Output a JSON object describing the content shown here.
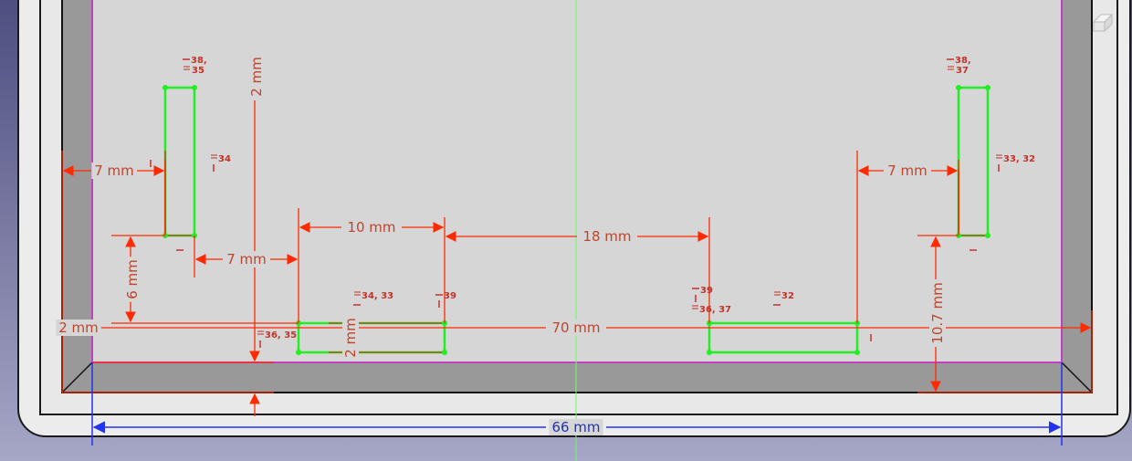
{
  "colors": {
    "background_top": "#5a5a86",
    "background_bottom": "#a2a2c4",
    "frame_outer": "#ececec",
    "frame_border": "#1a1a1a",
    "frame_wall": "#9a9a9a",
    "canvas": "#d6d6d6",
    "geometry": "#22ee22",
    "dimension": "#ff2a00",
    "dimension_text": "#c0442c",
    "reference_dimension": "#2233ee",
    "axis": "#66ff66",
    "edge_magenta": "#c040c0"
  },
  "dimensions": {
    "left_slot_offset": "7 mm",
    "right_slot_offset": "7 mm",
    "gap_to_pocket": "7 mm",
    "pocket_width": "10 mm",
    "pocket_spacing": "18 mm",
    "total_width": "70 mm",
    "inner_width": "66 mm",
    "left_height": "6 mm",
    "right_height": "10.7 mm",
    "vertical_clearance": "2 mm",
    "left_wall": "2 mm",
    "pocket_height": "2 mm"
  },
  "constraints": {
    "c1": "38,",
    "c2": "35",
    "c3": "38,",
    "c4": "37",
    "c5": "34",
    "c6": "33, 32",
    "c7": "34, 33",
    "c8": "39",
    "c9": "39",
    "c10": "36, 37",
    "c11": "32",
    "c12": "36, 35"
  },
  "icons": {
    "nav_cube": "nav-cube-icon"
  }
}
